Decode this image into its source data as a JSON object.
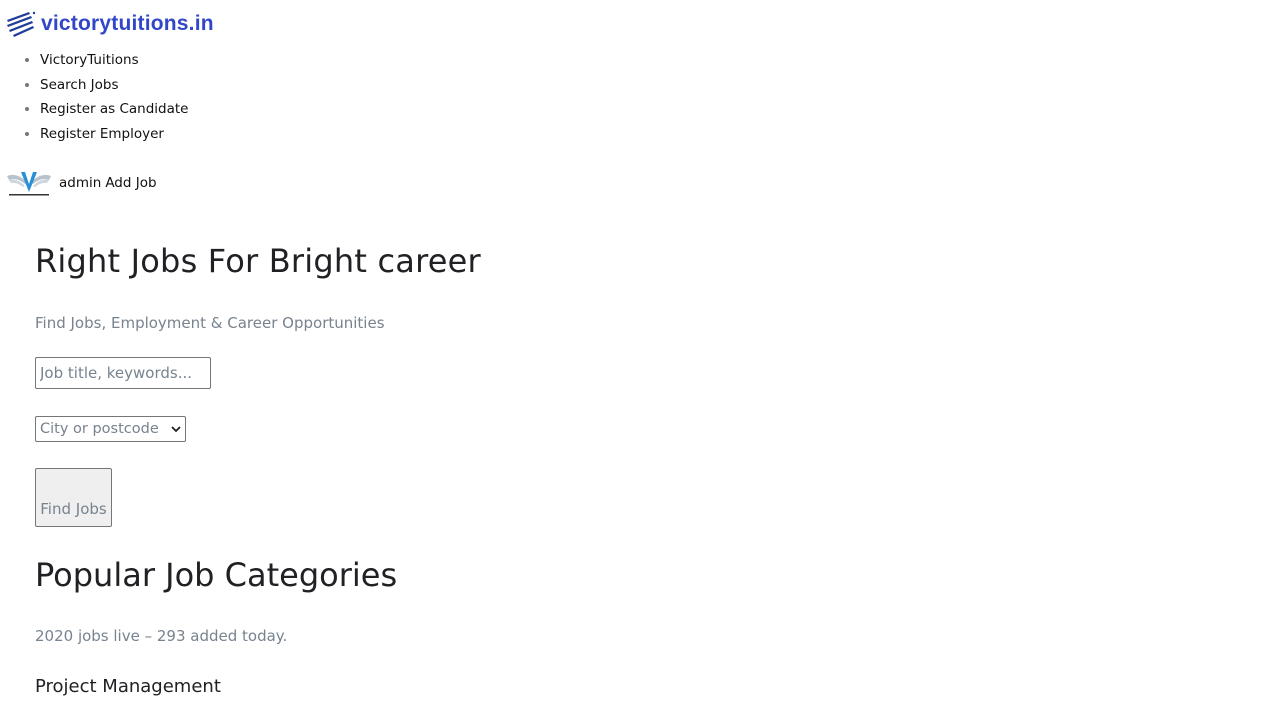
{
  "brand": {
    "logo_text": "victorytuitions.in",
    "color": "#3146c9"
  },
  "nav": {
    "items": [
      {
        "label": "VictoryTuitions"
      },
      {
        "label": "Search Jobs"
      },
      {
        "label": "Register as Candidate"
      },
      {
        "label": "Register Employer"
      }
    ]
  },
  "user": {
    "name": "admin",
    "add_job_label": "Add Job",
    "avatar_icon": "victory-wings-logo"
  },
  "hero": {
    "title": "Right Jobs For Bright career",
    "subtitle": "Find Jobs, Employment & Career Opportunities"
  },
  "search": {
    "keyword_placeholder": "Job title, keywords...",
    "location_selected": "City or postcode",
    "submit_label": "Find Jobs"
  },
  "categories": {
    "title": "Popular Job Categories",
    "stats": "2020 jobs live – 293 added today.",
    "items": [
      {
        "name": "Project Management"
      }
    ]
  }
}
